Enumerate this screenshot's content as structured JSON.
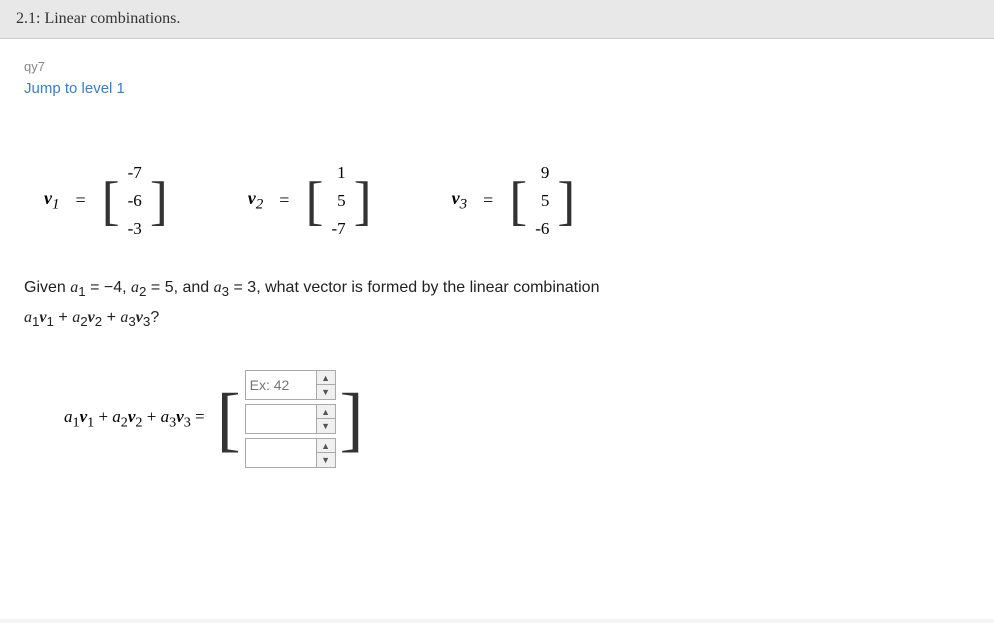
{
  "topbar": {
    "title": "2.1: Linear combinations."
  },
  "breadcrumb": "qy7",
  "jump_link": "Jump to level 1",
  "vectors": [
    {
      "name": "v₁",
      "name_sub": "1",
      "values": [
        "-7",
        "-6",
        "-3"
      ]
    },
    {
      "name": "v₂",
      "name_sub": "2",
      "values": [
        "1",
        "5",
        "-7"
      ]
    },
    {
      "name": "v₃",
      "name_sub": "3",
      "values": [
        "9",
        "5",
        "-6"
      ]
    }
  ],
  "description_line1": "Given a₁ = −4, a₂ = 5, and a₃ = 3, what vector is formed by the linear combination",
  "description_line2": "a₁v₁ + a₂v₂ + a₃v₃?",
  "answer_equation": "a₁v₁ + a₂v₂ + a₃v₃ =",
  "inputs": [
    {
      "placeholder": "Ex: 42",
      "value": ""
    },
    {
      "placeholder": "",
      "value": ""
    },
    {
      "placeholder": "",
      "value": ""
    }
  ],
  "colors": {
    "link": "#3a7ec4",
    "text": "#222",
    "topbar_bg": "#e8e8e8"
  }
}
